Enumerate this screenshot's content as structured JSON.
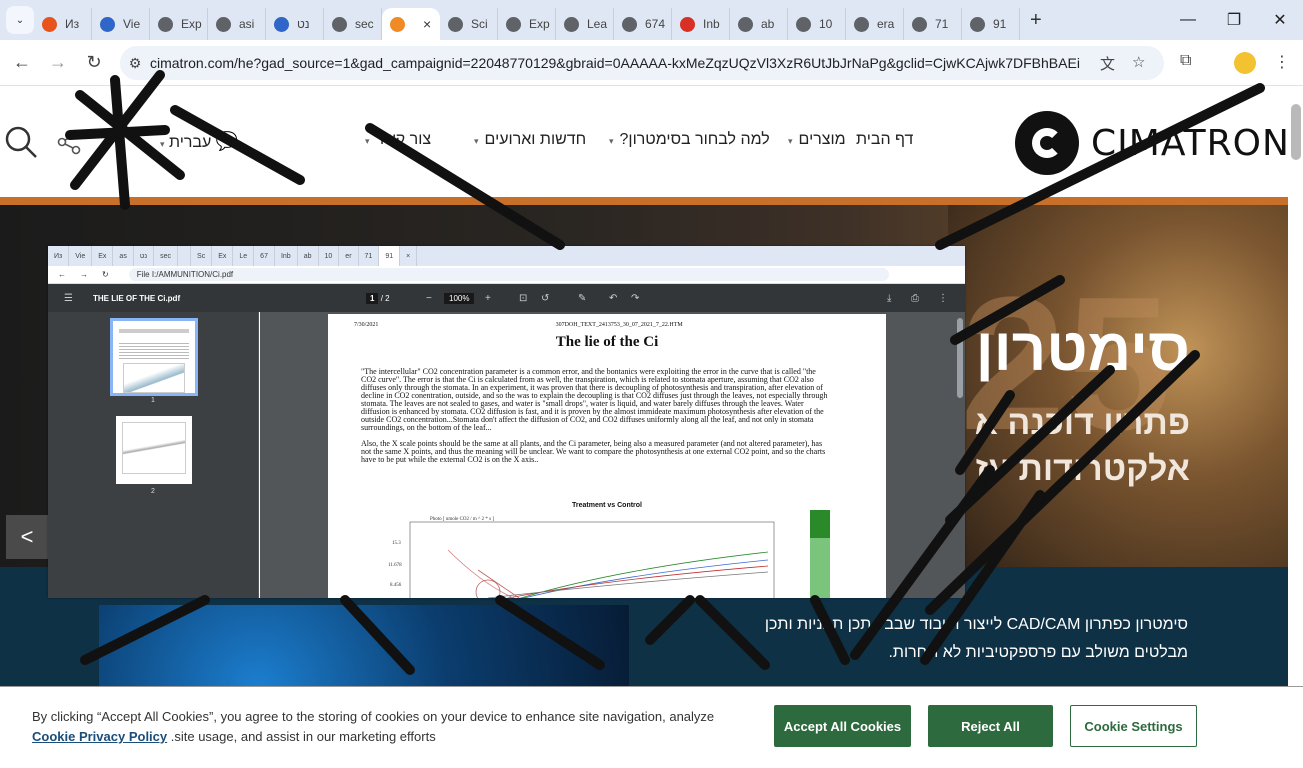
{
  "browser": {
    "tabs": [
      {
        "label": "Из",
        "fav_color": "#e8531c"
      },
      {
        "label": "Vie",
        "fav_color": "#2f66c7"
      },
      {
        "label": "Exp",
        "fav_color": "#5f6368"
      },
      {
        "label": "asi",
        "fav_color": "#5f6368"
      },
      {
        "label": "נט",
        "fav_color": "#2f66c7"
      },
      {
        "label": "sec",
        "fav_color": "#5f6368"
      },
      {
        "label": "",
        "fav_color": "#f08a24",
        "active": true
      },
      {
        "label": "Sci",
        "fav_color": "#5f6368"
      },
      {
        "label": "Exp",
        "fav_color": "#5f6368"
      },
      {
        "label": "Lea",
        "fav_color": "#5f6368"
      },
      {
        "label": "674",
        "fav_color": "#5f6368"
      },
      {
        "label": "Inb",
        "fav_color": "#d93025"
      },
      {
        "label": "ab",
        "fav_color": "#5f6368"
      },
      {
        "label": "10",
        "fav_color": "#5f6368"
      },
      {
        "label": "era",
        "fav_color": "#5f6368"
      },
      {
        "label": "71",
        "fav_color": "#5f6368"
      },
      {
        "label": "91",
        "fav_color": "#5f6368"
      }
    ],
    "active_tab_close": "×",
    "new_tab": "+",
    "address": "cimatron.com/he?gad_source=1&gad_campaignid=22048770129&gbraid=0AAAAA-kxMeZqzUQzVl3XzR6UtJbJrNaPg&gclid=CjwKCAjwk7DFBhBAEi..."
  },
  "site": {
    "logo_text": "CIMATRON",
    "menu": [
      {
        "label": "דף הבית",
        "caret": false
      },
      {
        "label": "מוצרים",
        "caret": true
      },
      {
        "label": "למה לבחור בסימטרון?",
        "caret": true
      },
      {
        "label": "חדשות וארועים",
        "caret": true
      },
      {
        "label": "צור קשר",
        "caret": true
      }
    ],
    "language": "עברית",
    "hero_title": "סימטרון",
    "hero_subtitle_1": "פתרון דוכנה א",
    "hero_subtitle_2": "אלקטרודות עז",
    "hero_big": "25",
    "hero_prev": "<",
    "band_text_1": "סימטרון כפתרון CAD/CAM לייצור ועיבוד שבבי, תכן תבניות ותכן",
    "band_text_2": "מבלטים משולב עם פרספקטיביות לא תחרות."
  },
  "screenshot": {
    "tabs": [
      "Из",
      "Vie",
      "Ex",
      "as",
      "נט",
      "sec",
      "",
      "Sc",
      "Ex",
      "Le",
      "67",
      "Inb",
      "ab",
      "10",
      "er",
      "71",
      "91",
      "×"
    ],
    "address": "File  I:/AMMUNITION/Ci.pdf",
    "pdf_title": "THE LIE OF THE Ci.pdf",
    "page_current": "1",
    "page_total": "/  2",
    "zoom": "100%",
    "thumb_1": "1",
    "thumb_2": "2",
    "page_date": "7/30/2021",
    "page_file": "307DOH_TEXT_2413753_30_07_2021_7_22.HTM",
    "doc_title": "The lie of the Ci",
    "para_1": "\"The intercellular\" CO2 concentration parameter is a common error, and the bontanics were exploiting the error in the curve that is called \"the CO2 curve\". The error is that the Ci is calculated from as well, the transpiration, which is related to stomata aperture, assuming that CO2 also diffuses only through the stomata. In an experiment, it was proven that there is decoupling of photosynthesis and transpiration, after elevation of decline in CO2 conentration, outside, and so the was to explain the decoupling is that CO2 diffuses just through the leaves, not especially through stomata. The leaves are not sealed to gases, and water is \"small drops\", water is liquid, and water barely diffuses through the leaves. Water diffusion is enhanced by stomata. CO2 diffusion is fast, and it is proven by the almost immideate maximum photosynthesis after elevation of the outside CO2 concentration...Stomata don't affect the diffusion of CO2, and CO2 diffuses uniformly along all the leaf, and not only in stomata surroundings, on the bottom of the leaf...",
    "para_2": "Also, the X scale points should be the same at all plants, and the Ci parameter, being also a measured parameter (and not altered parameter), has not the same X points, and thus the meaning will be unclear. We want to compare the photosynthesis at one external CO2 point, and so the charts have to be put while the external CO2 is on the X axis..",
    "chart_title": "Treatment vs Control",
    "chart_ylabel": "Photo [ umole CO2 / m ^ 2 * s ]",
    "chart_ticks": [
      "15.3",
      "11.678",
      "8.456"
    ]
  },
  "cookie": {
    "text_1": "By clicking “Accept All Cookies”, you agree to the storing of cookies on your device to enhance site navigation, analyze",
    "link": "Cookie Privacy Policy",
    "text_2": ".site usage, and assist in our marketing efforts",
    "accept": "Accept All Cookies",
    "reject": "Reject All",
    "settings": "Cookie Settings"
  }
}
